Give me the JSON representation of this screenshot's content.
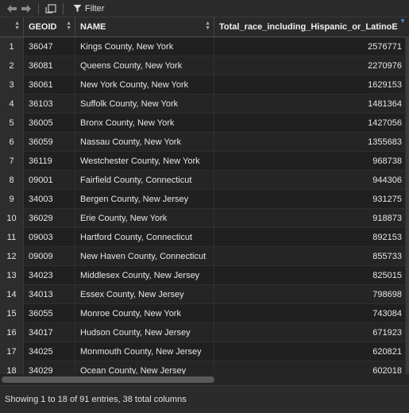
{
  "toolbar": {
    "back_icon": "arrow-left-icon",
    "forward_icon": "arrow-right-icon",
    "popout_icon": "popout-icon",
    "filter_icon": "funnel-icon",
    "filter_label": "Filter"
  },
  "table": {
    "columns": [
      "",
      "GEOID",
      "NAME",
      "Total_race_including_Hispanic_or_LatinoE"
    ],
    "rows": [
      {
        "n": "1",
        "geoid": "36047",
        "name": "Kings County, New York",
        "total": "2576771"
      },
      {
        "n": "2",
        "geoid": "36081",
        "name": "Queens County, New York",
        "total": "2270976"
      },
      {
        "n": "3",
        "geoid": "36061",
        "name": "New York County, New York",
        "total": "1629153"
      },
      {
        "n": "4",
        "geoid": "36103",
        "name": "Suffolk County, New York",
        "total": "1481364"
      },
      {
        "n": "5",
        "geoid": "36005",
        "name": "Bronx County, New York",
        "total": "1427056"
      },
      {
        "n": "6",
        "geoid": "36059",
        "name": "Nassau County, New York",
        "total": "1355683"
      },
      {
        "n": "7",
        "geoid": "36119",
        "name": "Westchester County, New York",
        "total": "968738"
      },
      {
        "n": "8",
        "geoid": "09001",
        "name": "Fairfield County, Connecticut",
        "total": "944306"
      },
      {
        "n": "9",
        "geoid": "34003",
        "name": "Bergen County, New Jersey",
        "total": "931275"
      },
      {
        "n": "10",
        "geoid": "36029",
        "name": "Erie County, New York",
        "total": "918873"
      },
      {
        "n": "11",
        "geoid": "09003",
        "name": "Hartford County, Connecticut",
        "total": "892153"
      },
      {
        "n": "12",
        "geoid": "09009",
        "name": "New Haven County, Connecticut",
        "total": "855733"
      },
      {
        "n": "13",
        "geoid": "34023",
        "name": "Middlesex County, New Jersey",
        "total": "825015"
      },
      {
        "n": "14",
        "geoid": "34013",
        "name": "Essex County, New Jersey",
        "total": "798698"
      },
      {
        "n": "15",
        "geoid": "36055",
        "name": "Monroe County, New York",
        "total": "743084"
      },
      {
        "n": "16",
        "geoid": "34017",
        "name": "Hudson County, New Jersey",
        "total": "671923"
      },
      {
        "n": "17",
        "geoid": "34025",
        "name": "Monmouth County, New Jersey",
        "total": "620821"
      },
      {
        "n": "18",
        "geoid": "34029",
        "name": "Ocean County, New Jersey",
        "total": "602018"
      }
    ]
  },
  "status": "Showing 1 to 18 of 91 entries, 38 total columns",
  "colors": {
    "accent_sort": "#4a90d9",
    "background": "#1e1e1e"
  }
}
